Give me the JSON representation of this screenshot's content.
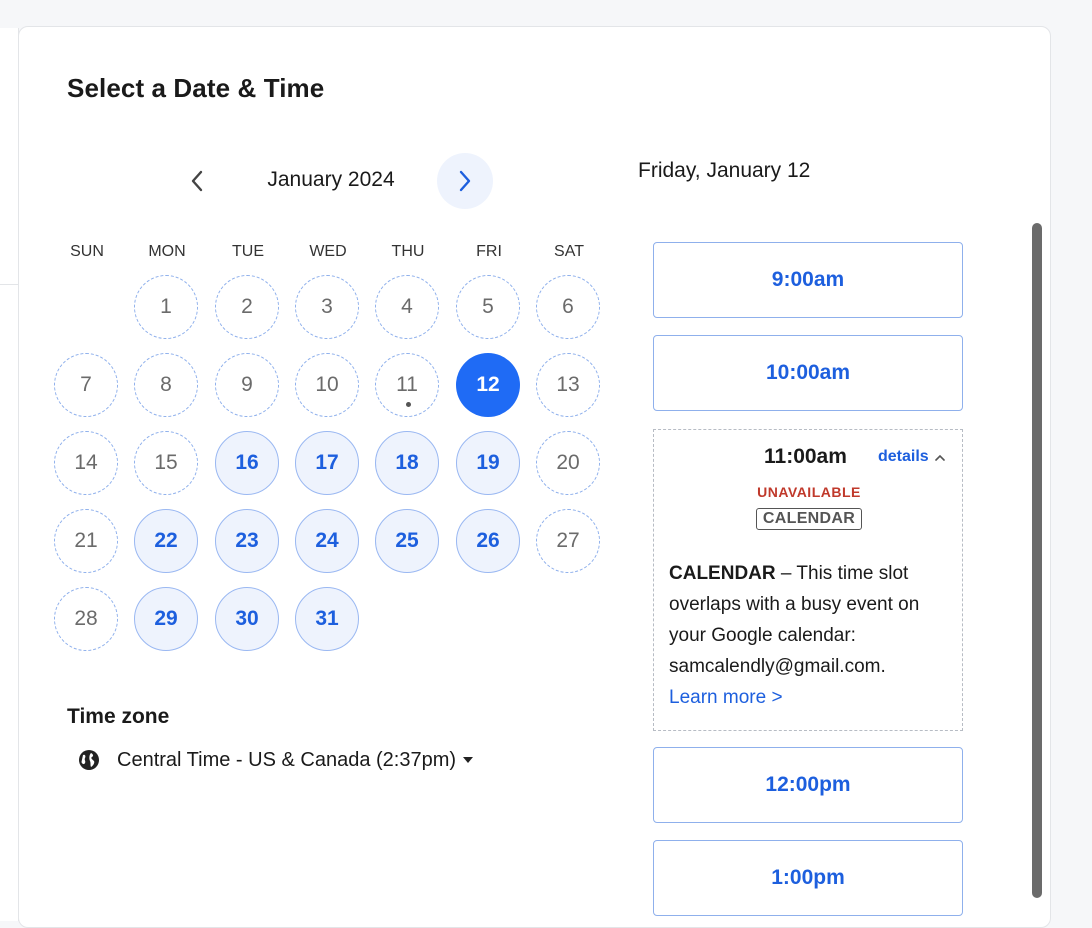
{
  "panel": {
    "title": "Select a Date & Time"
  },
  "calendar": {
    "month_label": "January 2024",
    "weekdays": [
      "SUN",
      "MON",
      "TUE",
      "WED",
      "THU",
      "FRI",
      "SAT"
    ],
    "first_weekday": 1,
    "selected_day": 12,
    "today": 11,
    "days": [
      {
        "n": "1",
        "state": "unavailable"
      },
      {
        "n": "2",
        "state": "unavailable"
      },
      {
        "n": "3",
        "state": "unavailable"
      },
      {
        "n": "4",
        "state": "unavailable"
      },
      {
        "n": "5",
        "state": "unavailable"
      },
      {
        "n": "6",
        "state": "unavailable"
      },
      {
        "n": "7",
        "state": "unavailable"
      },
      {
        "n": "8",
        "state": "unavailable"
      },
      {
        "n": "9",
        "state": "unavailable"
      },
      {
        "n": "10",
        "state": "unavailable"
      },
      {
        "n": "11",
        "state": "unavailable"
      },
      {
        "n": "12",
        "state": "selected"
      },
      {
        "n": "13",
        "state": "unavailable"
      },
      {
        "n": "14",
        "state": "unavailable"
      },
      {
        "n": "15",
        "state": "unavailable"
      },
      {
        "n": "16",
        "state": "available"
      },
      {
        "n": "17",
        "state": "available"
      },
      {
        "n": "18",
        "state": "available"
      },
      {
        "n": "19",
        "state": "available"
      },
      {
        "n": "20",
        "state": "unavailable"
      },
      {
        "n": "21",
        "state": "unavailable"
      },
      {
        "n": "22",
        "state": "available"
      },
      {
        "n": "23",
        "state": "available"
      },
      {
        "n": "24",
        "state": "available"
      },
      {
        "n": "25",
        "state": "available"
      },
      {
        "n": "26",
        "state": "available"
      },
      {
        "n": "27",
        "state": "unavailable"
      },
      {
        "n": "28",
        "state": "unavailable"
      },
      {
        "n": "29",
        "state": "available"
      },
      {
        "n": "30",
        "state": "available"
      },
      {
        "n": "31",
        "state": "available"
      }
    ]
  },
  "timezone": {
    "title": "Time zone",
    "label": "Central Time - US & Canada (2:37pm)",
    "icon": "globe-icon"
  },
  "day_panel": {
    "heading": "Friday, January 12",
    "slots": [
      {
        "time": "9:00am",
        "state": "available"
      },
      {
        "time": "10:00am",
        "state": "available"
      },
      {
        "time": "11:00am",
        "state": "unavailable"
      },
      {
        "time": "12:00pm",
        "state": "available"
      },
      {
        "time": "1:00pm",
        "state": "available"
      }
    ],
    "expanded": {
      "time": "11:00am",
      "details_label": "details",
      "status": "UNAVAILABLE",
      "badge": "CALENDAR",
      "desc_strong": "CALENDAR",
      "desc_text": " – This time slot overlaps with a busy event on your Google calendar: samcalendly@gmail.com.",
      "learn_more": "Learn more >"
    }
  },
  "colors": {
    "accent": "#1f6bf5",
    "unavailable_text": "#c0392b",
    "available_bg": "#eef3fd"
  }
}
